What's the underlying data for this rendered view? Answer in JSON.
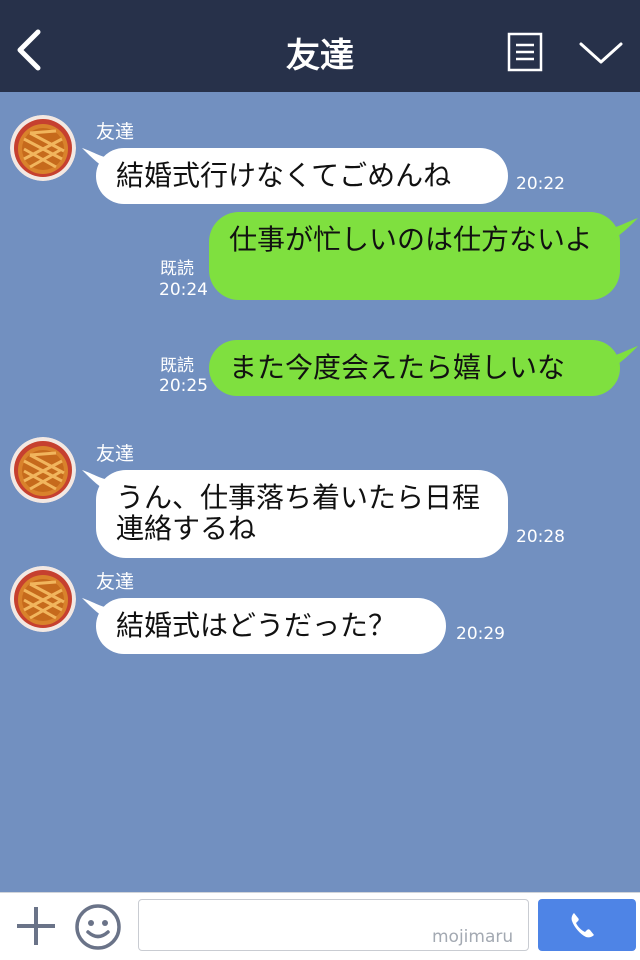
{
  "header": {
    "title": "友達"
  },
  "messages": [
    {
      "direction": "in",
      "sender": "友達",
      "text": "結婚式行けなくてごめんね",
      "time": "20:22"
    },
    {
      "direction": "out",
      "text": "仕事が忙しいのは仕方ないよ",
      "read": "既読",
      "time": "20:24"
    },
    {
      "direction": "out",
      "text": "また今度会えたら嬉しいな",
      "read": "既読",
      "time": "20:25"
    },
    {
      "direction": "in",
      "sender": "友達",
      "text": "うん、仕事落ち着いたら日程連絡するね",
      "time": "20:28"
    },
    {
      "direction": "in",
      "sender": "友達",
      "text": "結婚式はどうだった？",
      "time": "20:29"
    }
  ],
  "footer": {
    "watermark": "mojimaru"
  },
  "colors": {
    "header": "#27314a",
    "background": "#7290c0",
    "outgoing": "#7fe03f",
    "incoming": "#ffffff",
    "send": "#4e84e6"
  },
  "icons": [
    "back-arrow-icon",
    "list-menu-icon",
    "chevron-down-icon",
    "plus-icon",
    "smiley-icon",
    "phone-icon"
  ]
}
